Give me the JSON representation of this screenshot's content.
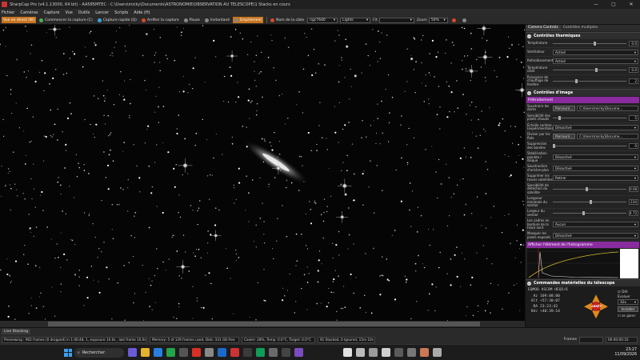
{
  "window": {
    "title": "SharpCap Pro (v4.1.13000, 64 bit) - AA585MTEC - C:\\Users\\micky\\Documents\\ASTRONOMIE\\OBSERVATION AU TELESCOPE\\1 Stacks en cours",
    "minimize": "—",
    "maximize": "▢",
    "close": "✕"
  },
  "menu": [
    "Fichier",
    "Caméras",
    "Capture",
    "Vue",
    "Outils",
    "Lancer",
    "Scripts",
    "Aide (H)"
  ],
  "toolbar": {
    "live_view": "Vue en direct (W)",
    "start_capture": "Commencer la capture (C)",
    "quick_capture": "Capture rapide (Q)",
    "stop_capture": "Arrêter la capture",
    "pause": "Pause",
    "snapshot": "Instantané",
    "stacking": "Empilement",
    "target_label": "Nom de la cible",
    "target_value": "ngc7640",
    "frame_type": "Lights",
    "fx_label": "FX",
    "zoom_label": "Zoom",
    "zoom_value": "50%"
  },
  "panel": {
    "tabs": [
      "Camera Controls",
      "Contrôles multiples"
    ],
    "thermal": {
      "title": "Contrôles thermiques",
      "rows": [
        {
          "label": "Température",
          "value": "0.0"
        },
        {
          "label": "Ventilateur",
          "select": "Activé"
        },
        {
          "label": "Refroidissement",
          "select": "Activé"
        },
        {
          "label": "Température cible",
          "value": "0.0"
        },
        {
          "label": "Puissance de chauffage de fenêtre",
          "value": "2"
        }
      ]
    },
    "image": {
      "title": "Contrôles d'image",
      "preprocessing": "Prétraitement",
      "rows": [
        {
          "label": "Soustraire les darks",
          "button": "Parcourir...",
          "path": "C:\\Users\\micky\\Docume..."
        },
        {
          "label": "Sensibilité des pixels chauds",
          "value": "5"
        },
        {
          "label": "Échelle sombre (expérimentale)",
          "select": "Désactivé"
        },
        {
          "label": "Diviser par les flats",
          "button": "Parcourir...",
          "path": "C:\\Users\\micky\\Docume..."
        },
        {
          "label": "Suppression des bandes",
          "value": "0"
        },
        {
          "label": "Stabilisation planète / disque",
          "select": "Désactivé"
        },
        {
          "label": "Soustraction d'arrière-plan",
          "select": "Désactivé"
        },
        {
          "label": "Supprimer les traces satellites",
          "select": "Retirer"
        },
        {
          "label": "Sensibilité de détection du satellite",
          "value": "0.00"
        },
        {
          "label": "Longueur minimale du sentier",
          "value": "234"
        },
        {
          "label": "Largeur du sentier",
          "value": "4.72"
        },
        {
          "label": "Les cadres en bordure de la trace sont",
          "select": "Aucun"
        },
        {
          "label": "Masquer les pixels exposés",
          "select": "Désactivé"
        }
      ]
    },
    "histogram": {
      "title": "Afficher l'élément de l'histogramme"
    },
    "scope": {
      "title": "Commandes matérielles du télescope",
      "mount": "EQMOD ASCOM HEQ5/6",
      "az_label": "Az",
      "az": "109:08:00",
      "alt_label": "Alt",
      "alt": "+57:30:07",
      "ra_label": "RA",
      "ra": "23:23:42",
      "dec_label": "Déc",
      "dec": "+40:39:14",
      "stop": "ARRÊT",
      "rate_label": "Évaluer",
      "rate": "32x",
      "install": "Installer",
      "tracking_label": "Dét",
      "park_label": "se garer"
    }
  },
  "status": {
    "tab": "Live Stacking",
    "previewing": "Previewing : 902 frames (0 dropped) in 1:40:48, 1, exposure 10.0s , last frame 10.0s",
    "memory": "Memory: 5 of 129 frames used, Disk: 331 GB free",
    "cooler": "Cooler: 28%, Temp: 0.0°C, Target: 0.0°C",
    "stacked": "91 Stacked, 0 Ignored, 15m 10s",
    "frames_label": "Frames",
    "time": "00:00:00:10"
  },
  "taskbar": {
    "search": "Rechercher",
    "clock_time": "23:27",
    "clock_date": "11/09/2026"
  },
  "colors": {
    "accent_orange": "#c97520",
    "section_purple": "#8a2ba0",
    "stop_red": "#c0261d"
  }
}
